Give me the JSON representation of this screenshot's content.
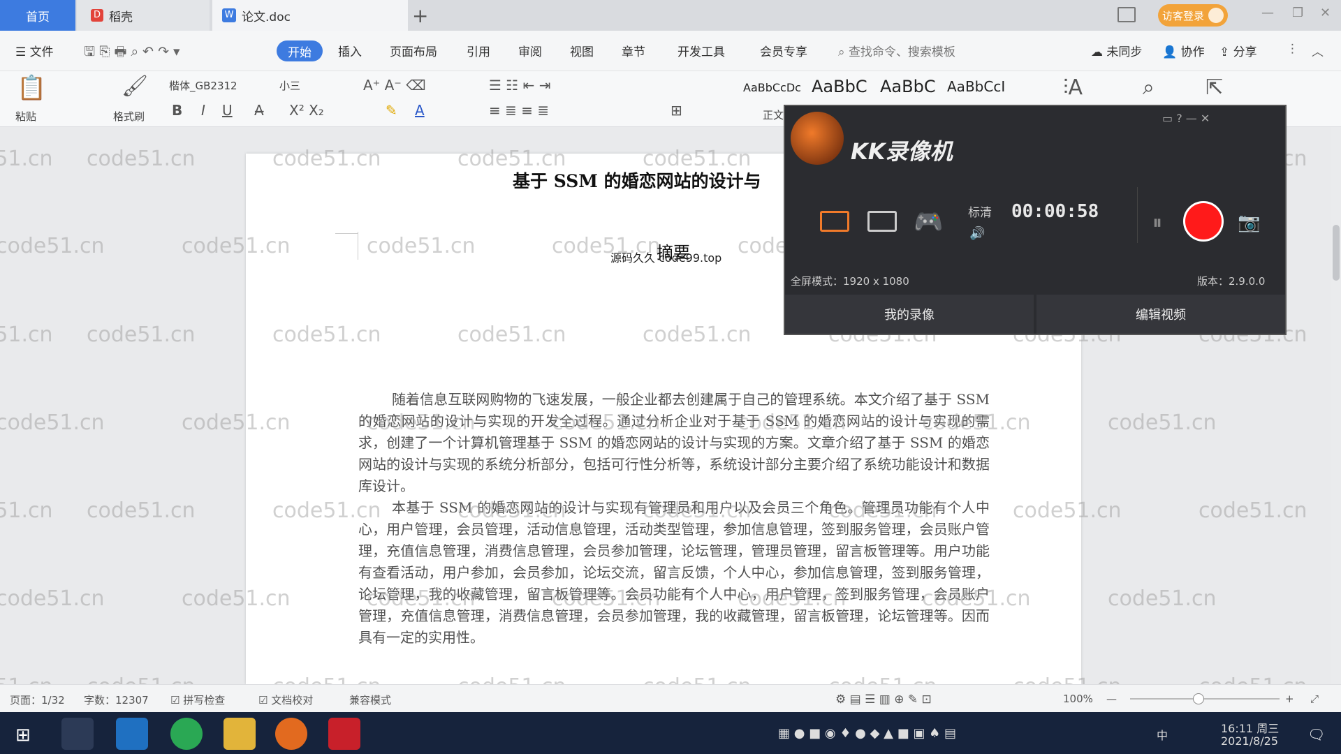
{
  "titlebar": {
    "tabs": [
      {
        "label": "首页"
      },
      {
        "label": "稻壳"
      },
      {
        "label": "论文.doc"
      }
    ],
    "new_tab": "+",
    "login": "访客登录",
    "window_controls": [
      "—",
      "❐",
      "✕"
    ]
  },
  "menubar": {
    "file": "文件",
    "items": [
      "开始",
      "插入",
      "页面布局",
      "引用",
      "审阅",
      "视图",
      "章节",
      "开发工具",
      "会员专享"
    ],
    "search": "查找命令、搜索模板",
    "sync": "未同步",
    "collab": "协作",
    "share": "分享"
  },
  "ribbon": {
    "paste": "粘贴",
    "format_painter": "格式刷",
    "font_name": "楷体_GB2312",
    "font_size": "小三",
    "styles": [
      "AaBbCcDc",
      "AaBbC",
      "AaBbC",
      "AaBbCcI"
    ],
    "style_label": "正文"
  },
  "document": {
    "title": "基于 SSM 的婚恋网站的设计与",
    "abstract_heading": "摘要",
    "overlay_mark": "源码久久 code99.top",
    "paragraphs": [
      "随着信息互联网购物的飞速发展，一般企业都去创建属于自己的管理系统。本文介绍了基于 SSM 的婚恋网站的设计与实现的开发全过程。通过分析企业对于基于 SSM 的婚恋网站的设计与实现的需求，创建了一个计算机管理基于 SSM 的婚恋网站的设计与实现的方案。文章介绍了基于 SSM 的婚恋网站的设计与实现的系统分析部分，包括可行性分析等，系统设计部分主要介绍了系统功能设计和数据库设计。",
      "本基于 SSM 的婚恋网站的设计与实现有管理员和用户以及会员三个角色。管理员功能有个人中心，用户管理，会员管理，活动信息管理，活动类型管理，参加信息管理，签到服务管理，会员账户管理，充值信息管理，消费信息管理，会员参加管理，论坛管理，管理员管理，留言板管理等。用户功能有查看活动，用户参加，会员参加，论坛交流，留言反馈，个人中心，参加信息管理，签到服务管理，论坛管理，我的收藏管理，留言板管理等。会员功能有个人中心，用户管理，签到服务管理，会员账户管理，充值信息管理，消费信息管理，会员参加管理，我的收藏管理，留言板管理，论坛管理等。因而具有一定的实用性。"
    ],
    "watermark": "code51.cn"
  },
  "statusbar": {
    "page": "页面：1/32",
    "words": "字数：12307",
    "spell": "拼写检查",
    "proof": "文档校对",
    "mode": "兼容模式",
    "zoom": "100%"
  },
  "recorder": {
    "name": "KK录像机",
    "quality": "标清",
    "timer": "00:00:58",
    "mode_info": "全屏模式：1920 x 1080",
    "version": "版本：2.9.0.0",
    "btn_my": "我的录像",
    "btn_edit": "编辑视频"
  },
  "taskbar": {
    "time": "16:11 周三",
    "date": "2021/8/25",
    "ime": "中"
  },
  "colors": {
    "accent": "#3d7be0",
    "record": "#ff1a1a",
    "login": "#f2a33a",
    "taskbar": "#16233c"
  }
}
